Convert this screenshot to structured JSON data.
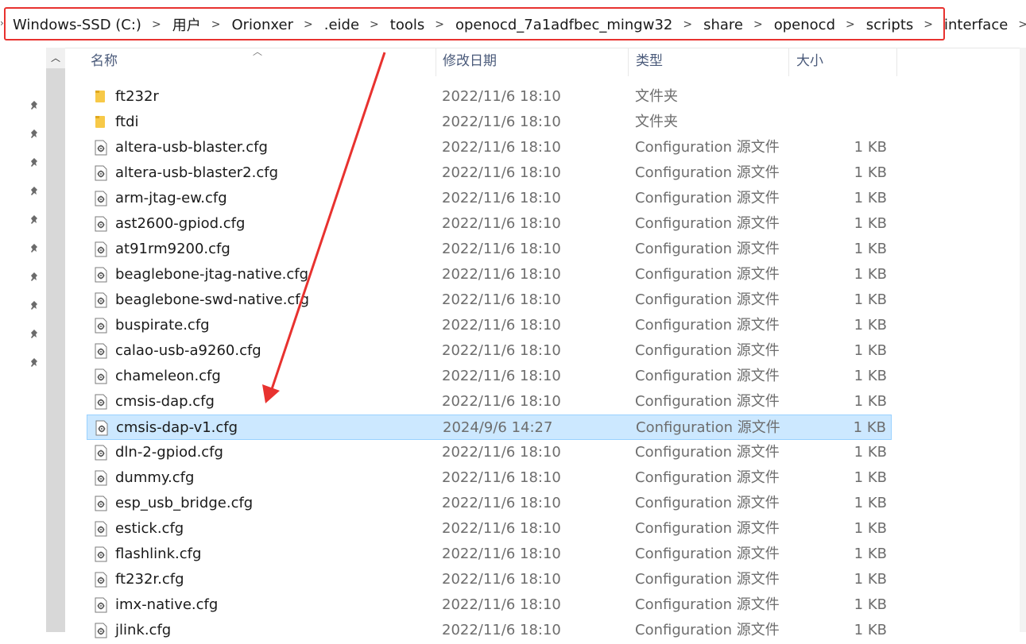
{
  "breadcrumb": {
    "items": [
      "Windows-SSD (C:)",
      "用户",
      "Orionxer",
      ".eide",
      "tools",
      "openocd_7a1adfbec_mingw32",
      "share",
      "openocd",
      "scripts",
      "interface"
    ],
    "separator": ">"
  },
  "columns": {
    "name": "名称",
    "date": "修改日期",
    "type": "类型",
    "size": "大小"
  },
  "rows": [
    {
      "name": "ft232r",
      "date": "2022/11/6 18:10",
      "type": "文件夹",
      "size": "",
      "kind": "folder"
    },
    {
      "name": "ftdi",
      "date": "2022/11/6 18:10",
      "type": "文件夹",
      "size": "",
      "kind": "folder"
    },
    {
      "name": "altera-usb-blaster.cfg",
      "date": "2022/11/6 18:10",
      "type": "Configuration 源文件",
      "size": "1 KB",
      "kind": "file"
    },
    {
      "name": "altera-usb-blaster2.cfg",
      "date": "2022/11/6 18:10",
      "type": "Configuration 源文件",
      "size": "1 KB",
      "kind": "file"
    },
    {
      "name": "arm-jtag-ew.cfg",
      "date": "2022/11/6 18:10",
      "type": "Configuration 源文件",
      "size": "1 KB",
      "kind": "file"
    },
    {
      "name": "ast2600-gpiod.cfg",
      "date": "2022/11/6 18:10",
      "type": "Configuration 源文件",
      "size": "1 KB",
      "kind": "file"
    },
    {
      "name": "at91rm9200.cfg",
      "date": "2022/11/6 18:10",
      "type": "Configuration 源文件",
      "size": "1 KB",
      "kind": "file"
    },
    {
      "name": "beaglebone-jtag-native.cfg",
      "date": "2022/11/6 18:10",
      "type": "Configuration 源文件",
      "size": "1 KB",
      "kind": "file"
    },
    {
      "name": "beaglebone-swd-native.cfg",
      "date": "2022/11/6 18:10",
      "type": "Configuration 源文件",
      "size": "1 KB",
      "kind": "file"
    },
    {
      "name": "buspirate.cfg",
      "date": "2022/11/6 18:10",
      "type": "Configuration 源文件",
      "size": "1 KB",
      "kind": "file"
    },
    {
      "name": "calao-usb-a9260.cfg",
      "date": "2022/11/6 18:10",
      "type": "Configuration 源文件",
      "size": "1 KB",
      "kind": "file"
    },
    {
      "name": "chameleon.cfg",
      "date": "2022/11/6 18:10",
      "type": "Configuration 源文件",
      "size": "1 KB",
      "kind": "file"
    },
    {
      "name": "cmsis-dap.cfg",
      "date": "2022/11/6 18:10",
      "type": "Configuration 源文件",
      "size": "1 KB",
      "kind": "file"
    },
    {
      "name": "cmsis-dap-v1.cfg",
      "date": "2024/9/6 14:27",
      "type": "Configuration 源文件",
      "size": "1 KB",
      "kind": "file",
      "selected": true
    },
    {
      "name": "dln-2-gpiod.cfg",
      "date": "2022/11/6 18:10",
      "type": "Configuration 源文件",
      "size": "1 KB",
      "kind": "file"
    },
    {
      "name": "dummy.cfg",
      "date": "2022/11/6 18:10",
      "type": "Configuration 源文件",
      "size": "1 KB",
      "kind": "file"
    },
    {
      "name": "esp_usb_bridge.cfg",
      "date": "2022/11/6 18:10",
      "type": "Configuration 源文件",
      "size": "1 KB",
      "kind": "file"
    },
    {
      "name": "estick.cfg",
      "date": "2022/11/6 18:10",
      "type": "Configuration 源文件",
      "size": "1 KB",
      "kind": "file"
    },
    {
      "name": "flashlink.cfg",
      "date": "2022/11/6 18:10",
      "type": "Configuration 源文件",
      "size": "1 KB",
      "kind": "file"
    },
    {
      "name": "ft232r.cfg",
      "date": "2022/11/6 18:10",
      "type": "Configuration 源文件",
      "size": "1 KB",
      "kind": "file"
    },
    {
      "name": "imx-native.cfg",
      "date": "2022/11/6 18:10",
      "type": "Configuration 源文件",
      "size": "1 KB",
      "kind": "file"
    },
    {
      "name": "jlink.cfg",
      "date": "2022/11/6 18:10",
      "type": "Configuration 源文件",
      "size": "1 KB",
      "kind": "file"
    }
  ],
  "colors": {
    "selection_bg": "#cce8ff",
    "selection_border": "#99d1ff",
    "annotation_red": "#e8322f",
    "header_text": "#4a5a7a",
    "folder_yellow": "#f7c948"
  },
  "icons": {
    "folder": "folder-icon",
    "file": "config-file-icon",
    "pin": "pin-icon",
    "separator": "chevron-right-icon"
  }
}
